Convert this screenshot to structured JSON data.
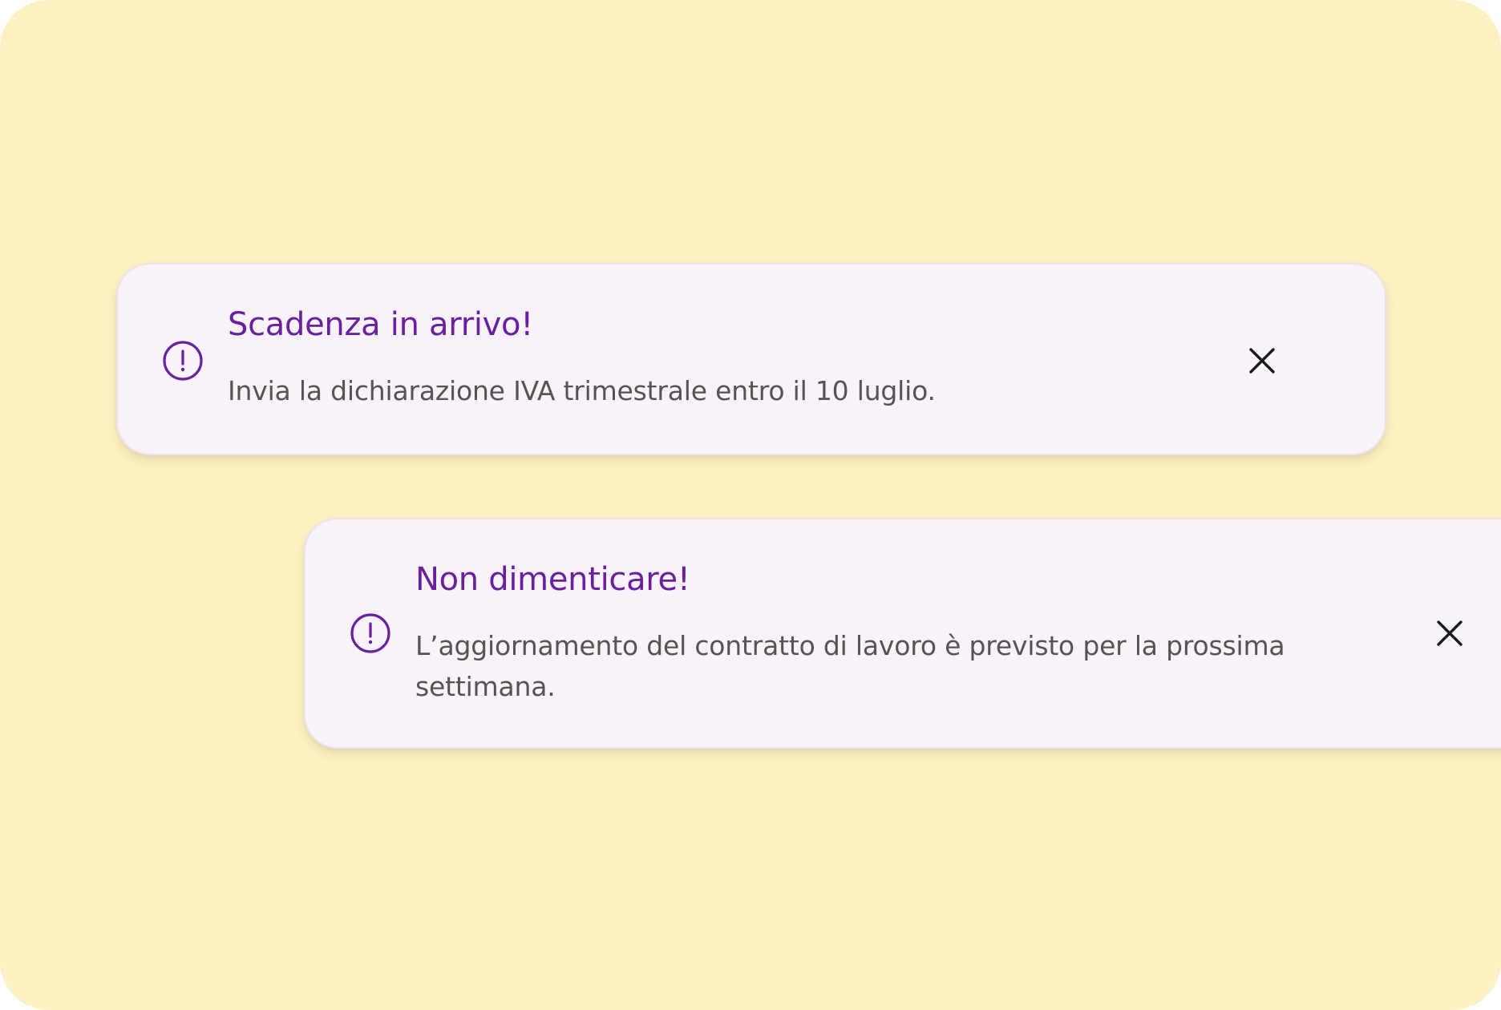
{
  "notifications": [
    {
      "title": "Scadenza in arrivo!",
      "message": "Invia la dichiarazione IVA trimestrale entro il 10 luglio.",
      "icon": "alert-circle-icon",
      "close_icon": "close-icon"
    },
    {
      "title": "Non dimenticare!",
      "message": "L’aggiornamento del contratto di lavoro è previsto per la prossima settimana.",
      "icon": "alert-circle-icon",
      "close_icon": "close-icon"
    }
  ],
  "colors": {
    "background": "#fdf1c3",
    "card": "#f8f2fb",
    "accent": "#6a1fa0",
    "text": "#5a5252",
    "close": "#1a1a1a"
  }
}
